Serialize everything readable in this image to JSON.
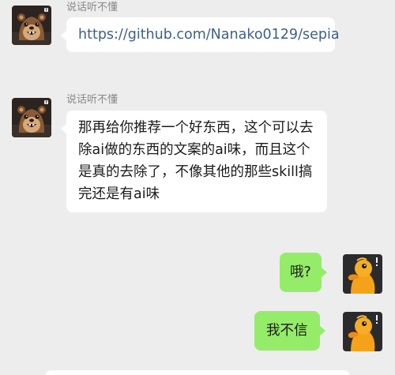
{
  "messages": [
    {
      "sender_name": "说话听不懂",
      "text": "https://github.com/Nanako0129/sepia",
      "direction": "incoming",
      "avatar_icon": "otter-avatar-icon"
    },
    {
      "sender_name": "说话听不懂",
      "text": "那再给你推荐一个好东西，这个可以去除ai做的东西的文案的ai味，而且这个是真的去除了，不像其他的那些skill搞完还是有ai味",
      "direction": "incoming",
      "avatar_icon": "otter-avatar-icon"
    },
    {
      "text": "哦?",
      "direction": "outgoing",
      "avatar_icon": "duck-avatar-icon"
    },
    {
      "text": "我不信",
      "direction": "outgoing",
      "avatar_icon": "duck-avatar-icon"
    }
  ],
  "colors": {
    "background": "#ededed",
    "incoming_bubble": "#ffffff",
    "outgoing_bubble": "#95ec69",
    "link": "#3f5f89"
  }
}
